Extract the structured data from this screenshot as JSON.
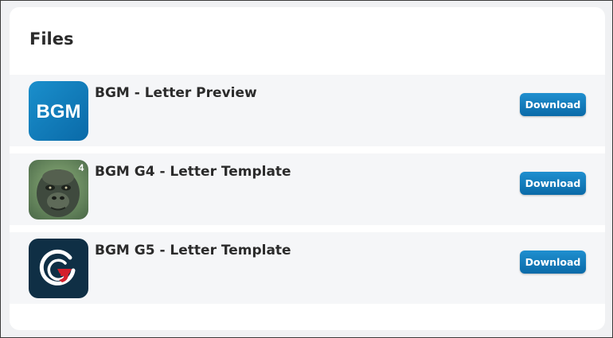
{
  "section": {
    "title": "Files"
  },
  "files": [
    {
      "name": "BGM - Letter Preview",
      "thumbnail_text": "BGM",
      "icon": "bgm-logo-icon",
      "download_label": "Download"
    },
    {
      "name": "BGM G4 - Letter Template",
      "thumbnail_text": "4",
      "icon": "gorilla-g4-icon",
      "download_label": "Download"
    },
    {
      "name": "BGM G5 - Letter Template",
      "icon": "g5-logo-icon",
      "download_label": "Download"
    }
  ],
  "colors": {
    "button": "#0a78b8",
    "bgm_logo_bg": "#1382c0",
    "g5_logo_bg": "#0f2f45",
    "g5_accent": "#d4202c",
    "row_bg": "#f5f6f8"
  }
}
